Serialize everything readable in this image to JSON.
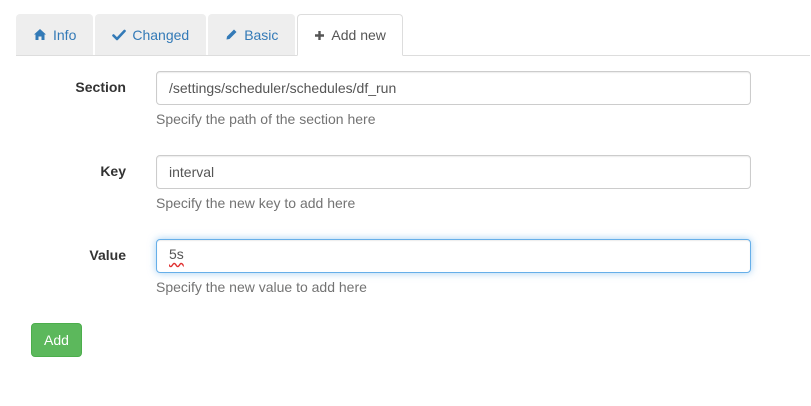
{
  "tabs": [
    {
      "label": "Info",
      "icon": "home-icon",
      "active": false
    },
    {
      "label": "Changed",
      "icon": "check-icon",
      "active": false
    },
    {
      "label": "Basic",
      "icon": "pencil-icon",
      "active": false
    },
    {
      "label": "Add new",
      "icon": "plus-icon",
      "active": true
    }
  ],
  "form": {
    "section": {
      "label": "Section",
      "value": "/settings/scheduler/schedules/df_run",
      "help": "Specify the path of the section here"
    },
    "key": {
      "label": "Key",
      "value": "interval",
      "help": "Specify the new key to add here"
    },
    "value": {
      "label": "Value",
      "value": "5s",
      "help": "Specify the new value to add here"
    }
  },
  "actions": {
    "add_label": "Add"
  },
  "colors": {
    "link": "#337ab7",
    "tab_bg": "#eeeeee",
    "add_button": "#5cb85c",
    "focus_border": "#66afe9",
    "help_text": "#737373"
  }
}
